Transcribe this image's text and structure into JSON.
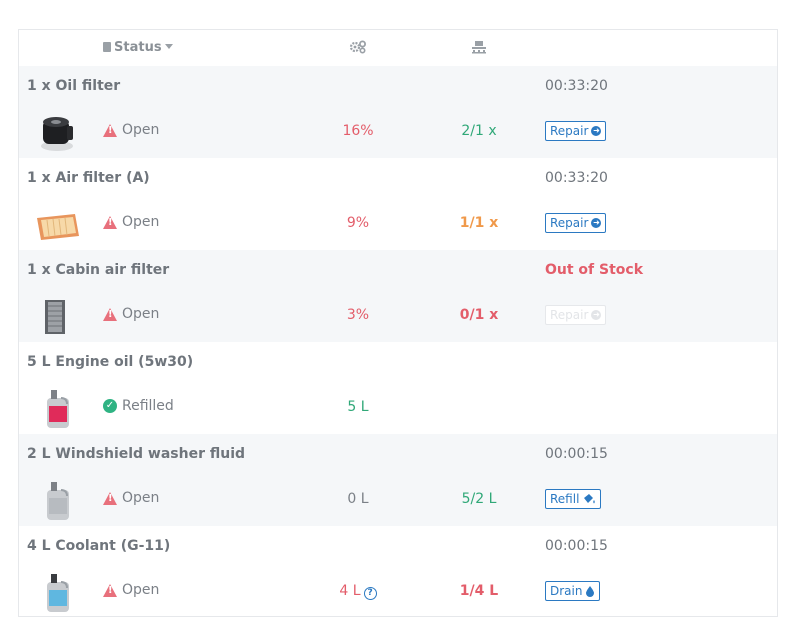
{
  "header": {
    "status_label": "Status"
  },
  "rows": [
    {
      "title": "1 x Oil filter",
      "right_top": "00:33:20",
      "status": "Open",
      "value": "16%",
      "qty": "2/1 x",
      "action": "Repair"
    },
    {
      "title": "1 x Air filter (A)",
      "right_top": "00:33:20",
      "status": "Open",
      "value": "9%",
      "qty": "1/1 x",
      "action": "Repair"
    },
    {
      "title": "1 x Cabin air filter",
      "right_top": "Out of Stock",
      "status": "Open",
      "value": "3%",
      "qty": "0/1 x",
      "action": "Repair"
    },
    {
      "title": "5 L Engine oil (5w30)",
      "right_top": "",
      "status": "Refilled",
      "value": "5 L",
      "qty": "",
      "action": ""
    },
    {
      "title": "2 L Windshield washer fluid",
      "right_top": "00:00:15",
      "status": "Open",
      "value": "0 L",
      "qty": "5/2 L",
      "action": "Refill"
    },
    {
      "title": "4 L Coolant (G-11)",
      "right_top": "00:00:15",
      "status": "Open",
      "value": "4 L",
      "qty": "1/4 L",
      "action": "Drain"
    }
  ],
  "icons": {
    "status_header": "clipboard-icon",
    "col2": "cogs-icon",
    "col3": "pallet-icon",
    "warning": "warning-icon",
    "ok": "check-circle-icon",
    "repair": "arrow-circle-right-icon",
    "refill": "fill-drip-icon",
    "drain": "droplet-icon",
    "help": "question-circle-icon"
  },
  "colors": {
    "danger": "#e35d6a",
    "success": "#30a878",
    "warning": "#f0994a",
    "primary": "#2b79c2"
  }
}
